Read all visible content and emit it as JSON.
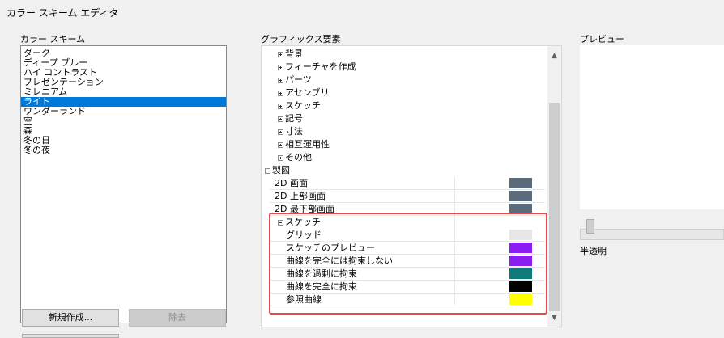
{
  "window": {
    "title": "カラー スキーム エディタ"
  },
  "scheme_panel": {
    "label": "カラー スキーム",
    "items": [
      "ダーク",
      "ディープ ブルー",
      "ハイ コントラスト",
      "プレゼンテーション",
      "ミレニアム",
      "ライト",
      "ワンダーランド",
      "空",
      "森",
      "冬の日",
      "冬の夜"
    ],
    "selected": "ライト",
    "new_button": "新規作成...",
    "delete_button": "除去"
  },
  "graphics_panel": {
    "label": "グラフィックス要素",
    "tree": [
      {
        "label": "背景",
        "expander": "plus"
      },
      {
        "label": "フィーチャを作成",
        "expander": "plus"
      },
      {
        "label": "パーツ",
        "expander": "plus"
      },
      {
        "label": "アセンブリ",
        "expander": "plus"
      },
      {
        "label": "スケッチ",
        "expander": "plus"
      },
      {
        "label": "記号",
        "expander": "plus"
      },
      {
        "label": "寸法",
        "expander": "plus"
      },
      {
        "label": "相互運用性",
        "expander": "plus"
      },
      {
        "label": "その他",
        "expander": "plus"
      },
      {
        "label": "製図",
        "expander": "minus"
      },
      {
        "label": "2D 画面",
        "color": "#5b6b7c"
      },
      {
        "label": "2D 上部画面",
        "color": "#5b6b7c"
      },
      {
        "label": "2D 最下部画面",
        "color": "#5b6b7c"
      },
      {
        "label": "スケッチ",
        "expander": "minus"
      },
      {
        "label": "グリッド",
        "color": "#e6e6e6"
      },
      {
        "label": "スケッチのプレビュー",
        "color": "#8a1ef0"
      },
      {
        "label": "曲線を完全には拘束しない",
        "color": "#8a1ef0"
      },
      {
        "label": "曲線を過剰に拘束",
        "color": "#0f7a7a"
      },
      {
        "label": "曲線を完全に拘束",
        "color": "#000000"
      },
      {
        "label": "参照曲線",
        "color": "#ffff00"
      }
    ]
  },
  "preview_panel": {
    "label": "プレビュー",
    "transparency_label": "半透明"
  }
}
